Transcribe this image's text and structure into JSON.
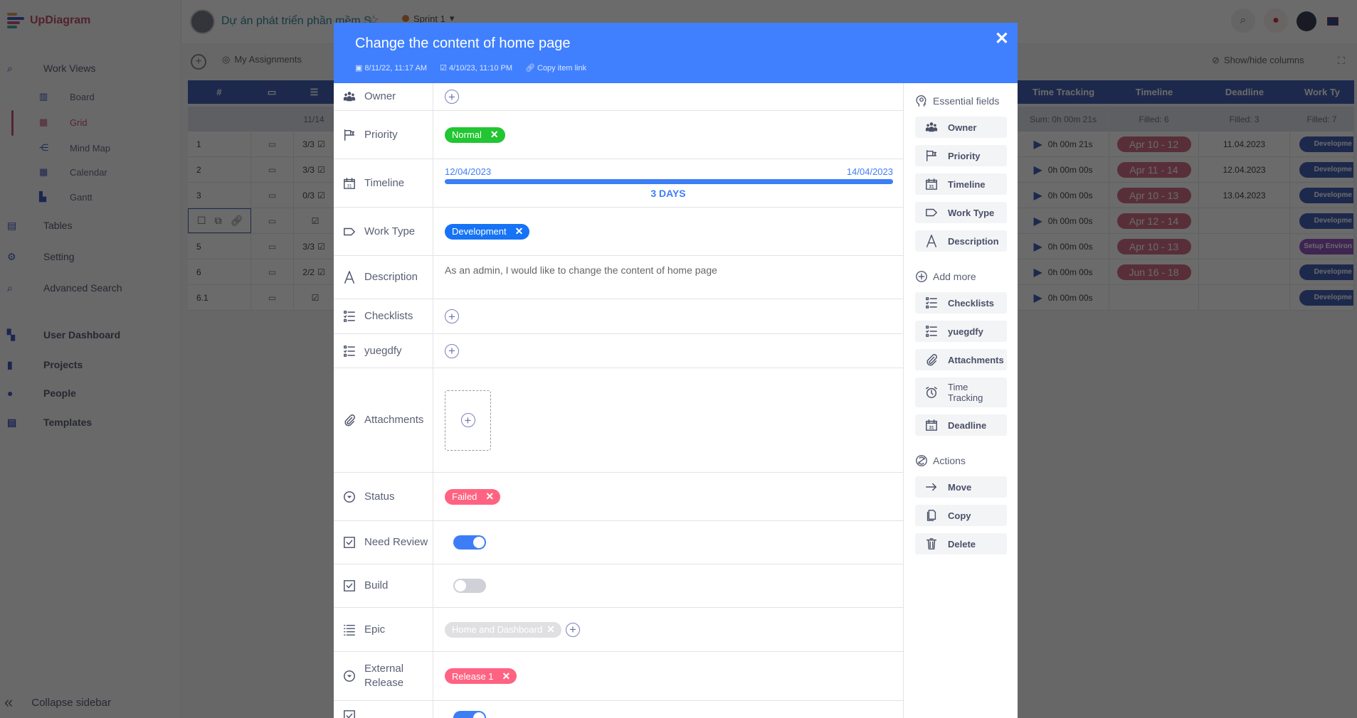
{
  "app": {
    "logo": "UpDiagram",
    "project_title": "Dự án phát triển phần mềm S",
    "sprint": "Sprint 1"
  },
  "sidebar": {
    "items": [
      {
        "label": "Work Views",
        "icon": "search-doc-icon",
        "level": "top"
      },
      {
        "label": "Board",
        "icon": "board-icon",
        "level": "sub"
      },
      {
        "label": "Grid",
        "icon": "grid-icon",
        "level": "sub",
        "active": true
      },
      {
        "label": "Mind Map",
        "icon": "mindmap-icon",
        "level": "sub"
      },
      {
        "label": "Calendar",
        "icon": "calendar-icon",
        "level": "sub"
      },
      {
        "label": "Gantt",
        "icon": "gantt-icon",
        "level": "sub"
      },
      {
        "label": "Tables",
        "icon": "table-icon",
        "level": "top"
      },
      {
        "label": "Setting",
        "icon": "gear-icon",
        "level": "top"
      },
      {
        "label": "Advanced Search",
        "icon": "search-icon",
        "level": "top"
      },
      {
        "label": "User Dashboard",
        "icon": "dashboard-icon",
        "level": "top"
      },
      {
        "label": "Projects",
        "icon": "book-icon",
        "level": "top"
      },
      {
        "label": "People",
        "icon": "person-icon",
        "level": "top"
      },
      {
        "label": "Templates",
        "icon": "clipboard-icon",
        "level": "top"
      }
    ],
    "collapse_label": "Collapse sidebar"
  },
  "toolbar": {
    "my_assignments": "My Assignments",
    "show_hide_columns": "Show/hide columns"
  },
  "grid": {
    "headers": {
      "number": "#",
      "time_tracking": "Time Tracking",
      "timeline": "Timeline",
      "deadline": "Deadline",
      "work_type": "Work Ty"
    },
    "summary": {
      "checklist": "11/14",
      "time_tracking": "Sum:  0h 00m 21s",
      "timeline": "Filled: 6",
      "deadline": "Filled: 3",
      "work_type": "Filled: 7"
    },
    "rows": [
      {
        "num": "1",
        "checklist": "3/3",
        "time": "0h 00m 21s",
        "timeline": "Apr 10 - 12",
        "deadline": "11.04.2023",
        "work_type": "Developme"
      },
      {
        "num": "2",
        "checklist": "3/3",
        "time": "0h 00m 00s",
        "timeline": "Apr 11 - 14",
        "deadline": "12.04.2023",
        "work_type": "Developme"
      },
      {
        "num": "3",
        "checklist": "0/3",
        "time": "0h 00m 00s",
        "timeline": "Apr 10 - 13",
        "deadline": "13.04.2023",
        "work_type": "Developme"
      },
      {
        "num": "",
        "checklist": "",
        "time": "0h 00m 00s",
        "timeline": "Apr 12 - 14",
        "deadline": "",
        "work_type": "Developme",
        "selected": true
      },
      {
        "num": "5",
        "checklist": "3/3",
        "time": "0h 00m 00s",
        "timeline": "Apr 10 - 13",
        "deadline": "",
        "work_type": "Setup Environ"
      },
      {
        "num": "6",
        "checklist": "2/2",
        "time": "0h 00m 00s",
        "timeline": "Jun 16 - 18",
        "deadline": "",
        "work_type": "Developme"
      },
      {
        "num": "6.1",
        "checklist": "",
        "time": "0h 00m 00s",
        "timeline": "",
        "deadline": "",
        "work_type": "Developme"
      }
    ]
  },
  "modal": {
    "title": "Change the content of home page",
    "created": "8/11/22, 11:17 AM",
    "updated": "4/10/23, 11:10 PM",
    "copy_link": "Copy item link",
    "fields": [
      {
        "label": "Owner",
        "icon": "users-icon",
        "type": "add"
      },
      {
        "label": "Priority",
        "icon": "flag-icon",
        "type": "tag",
        "value": "Normal",
        "color": "#22c532"
      },
      {
        "label": "Timeline",
        "icon": "calendar-icon",
        "type": "timeline",
        "start": "12/04/2023",
        "end": "14/04/2023",
        "duration": "3 DAYS"
      },
      {
        "label": "Work Type",
        "icon": "tag-icon",
        "type": "tag",
        "value": "Development",
        "color": "#1673f5"
      },
      {
        "label": "Description",
        "icon": "text-icon",
        "type": "text",
        "value": "As an admin, I would like to change the content of home page"
      },
      {
        "label": "Checklists",
        "icon": "checklist-icon",
        "type": "add"
      },
      {
        "label": "yuegdfy",
        "icon": "checklist-icon",
        "type": "add"
      },
      {
        "label": "Attachments",
        "icon": "paperclip-icon",
        "type": "attach"
      },
      {
        "label": "Status",
        "icon": "dropdown-circle-icon",
        "type": "tag",
        "value": "Failed",
        "color": "#ff6382"
      },
      {
        "label": "Need Review",
        "icon": "checkbox-icon",
        "type": "toggle",
        "on": true
      },
      {
        "label": "Build",
        "icon": "checkbox-icon",
        "type": "toggle",
        "on": false
      },
      {
        "label": "Epic",
        "icon": "list-icon",
        "type": "epic",
        "value": "Home and Dashboard",
        "color": "#e0e0e2"
      },
      {
        "label": "External Release",
        "icon": "dropdown-circle-icon",
        "type": "tag",
        "value": "Release 1",
        "color": "#ff6382"
      },
      {
        "label": "",
        "icon": "checkbox-icon",
        "type": "toggle",
        "on": true
      }
    ],
    "side": {
      "essential_title": "Essential fields",
      "essential": [
        {
          "label": "Owner",
          "icon": "users-icon"
        },
        {
          "label": "Priority",
          "icon": "flag-icon"
        },
        {
          "label": "Timeline",
          "icon": "calendar-icon"
        },
        {
          "label": "Work Type",
          "icon": "tag-icon"
        },
        {
          "label": "Description",
          "icon": "text-icon"
        }
      ],
      "add_more_title": "Add more",
      "add_more": [
        {
          "label": "Checklists",
          "icon": "checklist-icon"
        },
        {
          "label": "yuegdfy",
          "icon": "checklist-icon"
        },
        {
          "label": "Attachments",
          "icon": "paperclip-icon"
        },
        {
          "label": "Time Tracking",
          "icon": "alarm-icon"
        },
        {
          "label": "Deadline",
          "icon": "calendar-icon"
        }
      ],
      "actions_title": "Actions",
      "actions": [
        {
          "label": "Move",
          "icon": "arrow-right-icon"
        },
        {
          "label": "Copy",
          "icon": "copy-icon"
        },
        {
          "label": "Delete",
          "icon": "trash-icon"
        }
      ]
    }
  },
  "colors": {
    "header_blue": "#4080ff",
    "timeline_blue": "#3d7ef7",
    "toggle_on": "#3d7ef7",
    "toggle_off": "#cfd0d8",
    "grid_header": "#3d62c9",
    "timeline_pill": "#e56a86"
  }
}
